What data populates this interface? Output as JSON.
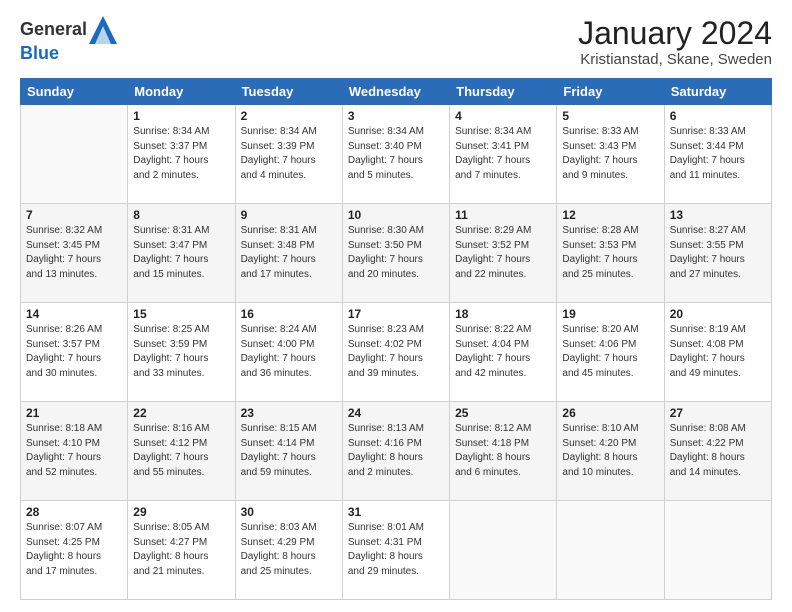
{
  "header": {
    "logo_line1": "General",
    "logo_line2": "Blue",
    "month_title": "January 2024",
    "location": "Kristianstad, Skane, Sweden"
  },
  "days_of_week": [
    "Sunday",
    "Monday",
    "Tuesday",
    "Wednesday",
    "Thursday",
    "Friday",
    "Saturday"
  ],
  "weeks": [
    [
      {
        "day": "",
        "info": ""
      },
      {
        "day": "1",
        "info": "Sunrise: 8:34 AM\nSunset: 3:37 PM\nDaylight: 7 hours\nand 2 minutes."
      },
      {
        "day": "2",
        "info": "Sunrise: 8:34 AM\nSunset: 3:39 PM\nDaylight: 7 hours\nand 4 minutes."
      },
      {
        "day": "3",
        "info": "Sunrise: 8:34 AM\nSunset: 3:40 PM\nDaylight: 7 hours\nand 5 minutes."
      },
      {
        "day": "4",
        "info": "Sunrise: 8:34 AM\nSunset: 3:41 PM\nDaylight: 7 hours\nand 7 minutes."
      },
      {
        "day": "5",
        "info": "Sunrise: 8:33 AM\nSunset: 3:43 PM\nDaylight: 7 hours\nand 9 minutes."
      },
      {
        "day": "6",
        "info": "Sunrise: 8:33 AM\nSunset: 3:44 PM\nDaylight: 7 hours\nand 11 minutes."
      }
    ],
    [
      {
        "day": "7",
        "info": "Sunrise: 8:32 AM\nSunset: 3:45 PM\nDaylight: 7 hours\nand 13 minutes."
      },
      {
        "day": "8",
        "info": "Sunrise: 8:31 AM\nSunset: 3:47 PM\nDaylight: 7 hours\nand 15 minutes."
      },
      {
        "day": "9",
        "info": "Sunrise: 8:31 AM\nSunset: 3:48 PM\nDaylight: 7 hours\nand 17 minutes."
      },
      {
        "day": "10",
        "info": "Sunrise: 8:30 AM\nSunset: 3:50 PM\nDaylight: 7 hours\nand 20 minutes."
      },
      {
        "day": "11",
        "info": "Sunrise: 8:29 AM\nSunset: 3:52 PM\nDaylight: 7 hours\nand 22 minutes."
      },
      {
        "day": "12",
        "info": "Sunrise: 8:28 AM\nSunset: 3:53 PM\nDaylight: 7 hours\nand 25 minutes."
      },
      {
        "day": "13",
        "info": "Sunrise: 8:27 AM\nSunset: 3:55 PM\nDaylight: 7 hours\nand 27 minutes."
      }
    ],
    [
      {
        "day": "14",
        "info": "Sunrise: 8:26 AM\nSunset: 3:57 PM\nDaylight: 7 hours\nand 30 minutes."
      },
      {
        "day": "15",
        "info": "Sunrise: 8:25 AM\nSunset: 3:59 PM\nDaylight: 7 hours\nand 33 minutes."
      },
      {
        "day": "16",
        "info": "Sunrise: 8:24 AM\nSunset: 4:00 PM\nDaylight: 7 hours\nand 36 minutes."
      },
      {
        "day": "17",
        "info": "Sunrise: 8:23 AM\nSunset: 4:02 PM\nDaylight: 7 hours\nand 39 minutes."
      },
      {
        "day": "18",
        "info": "Sunrise: 8:22 AM\nSunset: 4:04 PM\nDaylight: 7 hours\nand 42 minutes."
      },
      {
        "day": "19",
        "info": "Sunrise: 8:20 AM\nSunset: 4:06 PM\nDaylight: 7 hours\nand 45 minutes."
      },
      {
        "day": "20",
        "info": "Sunrise: 8:19 AM\nSunset: 4:08 PM\nDaylight: 7 hours\nand 49 minutes."
      }
    ],
    [
      {
        "day": "21",
        "info": "Sunrise: 8:18 AM\nSunset: 4:10 PM\nDaylight: 7 hours\nand 52 minutes."
      },
      {
        "day": "22",
        "info": "Sunrise: 8:16 AM\nSunset: 4:12 PM\nDaylight: 7 hours\nand 55 minutes."
      },
      {
        "day": "23",
        "info": "Sunrise: 8:15 AM\nSunset: 4:14 PM\nDaylight: 7 hours\nand 59 minutes."
      },
      {
        "day": "24",
        "info": "Sunrise: 8:13 AM\nSunset: 4:16 PM\nDaylight: 8 hours\nand 2 minutes."
      },
      {
        "day": "25",
        "info": "Sunrise: 8:12 AM\nSunset: 4:18 PM\nDaylight: 8 hours\nand 6 minutes."
      },
      {
        "day": "26",
        "info": "Sunrise: 8:10 AM\nSunset: 4:20 PM\nDaylight: 8 hours\nand 10 minutes."
      },
      {
        "day": "27",
        "info": "Sunrise: 8:08 AM\nSunset: 4:22 PM\nDaylight: 8 hours\nand 14 minutes."
      }
    ],
    [
      {
        "day": "28",
        "info": "Sunrise: 8:07 AM\nSunset: 4:25 PM\nDaylight: 8 hours\nand 17 minutes."
      },
      {
        "day": "29",
        "info": "Sunrise: 8:05 AM\nSunset: 4:27 PM\nDaylight: 8 hours\nand 21 minutes."
      },
      {
        "day": "30",
        "info": "Sunrise: 8:03 AM\nSunset: 4:29 PM\nDaylight: 8 hours\nand 25 minutes."
      },
      {
        "day": "31",
        "info": "Sunrise: 8:01 AM\nSunset: 4:31 PM\nDaylight: 8 hours\nand 29 minutes."
      },
      {
        "day": "",
        "info": ""
      },
      {
        "day": "",
        "info": ""
      },
      {
        "day": "",
        "info": ""
      }
    ]
  ]
}
